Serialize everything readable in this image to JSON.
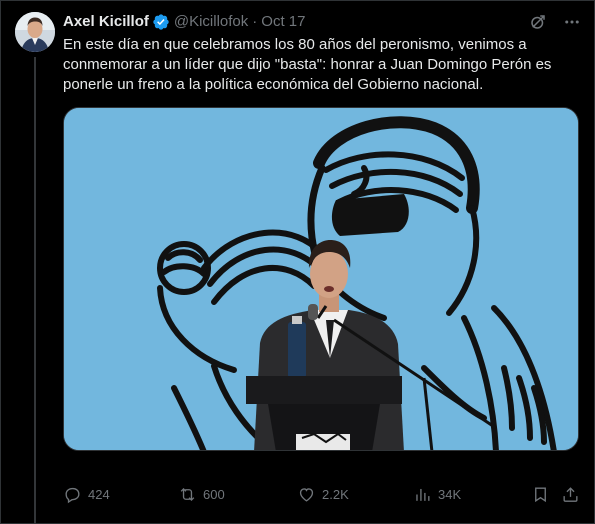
{
  "tweet": {
    "author": {
      "display_name": "Axel Kicillof",
      "handle": "@Kicillofok",
      "verified": true,
      "verified_color": "#1d9bf0"
    },
    "separator": "·",
    "date": "Oct 17",
    "text": "En este día en que celebramos los 80 años del peronismo, venimos a\nconmemorar a un líder que dijo \"basta\": honrar a Juan Domingo Perón es\nponerle un freno a la política económica del Gobierno nacional.",
    "header_icons": [
      "grok-icon",
      "more-icon"
    ],
    "media": {
      "background_color": "#72b7de",
      "line_art_color": "#111111"
    },
    "actions": {
      "reply_count": "424",
      "repost_count": "600",
      "like_count": "2.2K",
      "view_count": "34K"
    }
  },
  "colors": {
    "background": "#000000",
    "text": "#e7e9ea",
    "muted": "#71767b",
    "divider": "#2f3336"
  }
}
